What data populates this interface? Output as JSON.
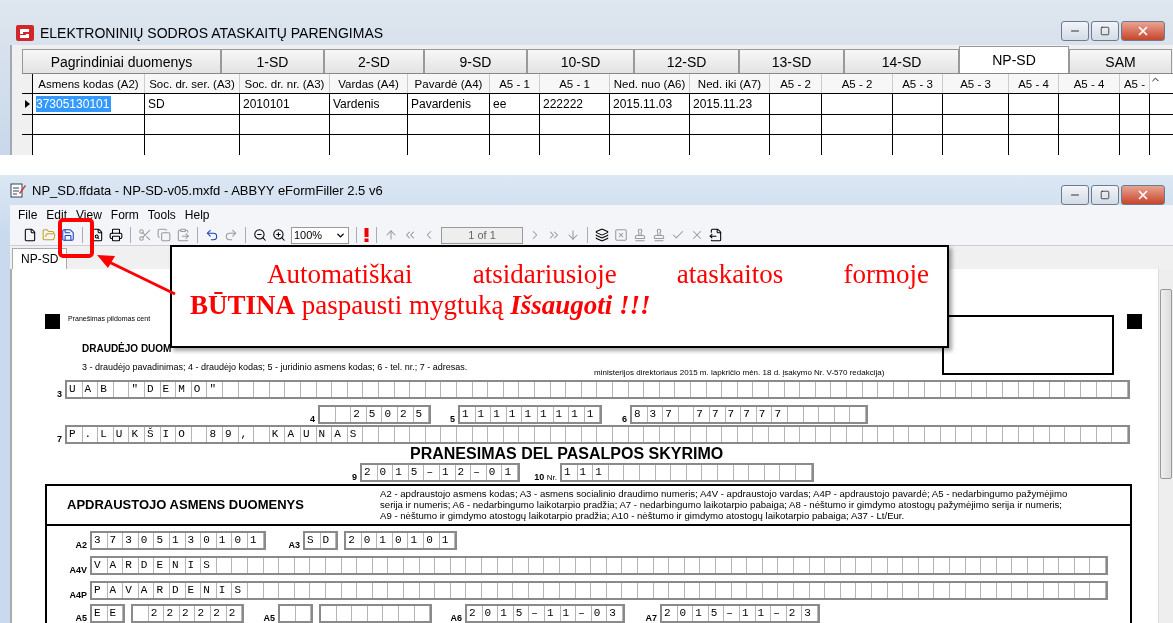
{
  "top_window": {
    "title": "ELEKTRONINIŲ SODROS ATASKAITŲ PARENGIMAS",
    "tabs": [
      {
        "label": "Pagrindiniai duomenys",
        "selected": false
      },
      {
        "label": "1-SD",
        "selected": false
      },
      {
        "label": "2-SD",
        "selected": false
      },
      {
        "label": "9-SD",
        "selected": false
      },
      {
        "label": "10-SD",
        "selected": false
      },
      {
        "label": "12-SD",
        "selected": false
      },
      {
        "label": "13-SD",
        "selected": false
      },
      {
        "label": "14-SD",
        "selected": false
      },
      {
        "label": "NP-SD",
        "selected": true
      },
      {
        "label": "SAM",
        "selected": false
      }
    ],
    "table": {
      "columns": [
        "Asmens kodas (A2)",
        "Soc. dr. ser. (A3)",
        "Soc. dr. nr. (A3)",
        "Vardas (A4)",
        "Pavardė (A4)",
        "A5 - 1",
        "A5 - 1",
        "Ned. nuo (A6)",
        "Ned. iki (A7)",
        "A5 - 2",
        "A5 - 2",
        "A5 - 3",
        "A5 - 3",
        "A5 - 4",
        "A5 - 4",
        "A5 -"
      ],
      "rows": [
        {
          "selected": true,
          "cells": [
            "37305130101",
            "SD",
            "2010101",
            "Vardenis",
            "Pavardenis",
            "ee",
            "222222",
            "2015.11.03",
            "2015.11.23"
          ]
        }
      ]
    }
  },
  "bottom_window": {
    "title": "NP_SD.ffdata - NP-SD-v05.mxfd - ABBYY eFormFiller 2.5 v6",
    "menu": [
      "File",
      "Edit",
      "View",
      "Form",
      "Tools",
      "Help"
    ],
    "toolbar": {
      "zoom": "100%",
      "page": "1 of 1"
    },
    "document_tab": "NP-SD",
    "form": {
      "note": "Pranešimas pildomas cent",
      "heading": "DRAUDĖJO DUOM",
      "legend": "3 - draudėjo pavadinimas; 4 - draudėjo kodas; 5 - juridinio asmens kodas; 6 - tel. nr.; 7 - adresas.",
      "order_note": "ministerijos direktoriaus 2015 m. lapkričio mėn. 18 d. įsakymo Nr. V-570 redakcija)",
      "field_3": {
        "label": "3",
        "value": "UAB \"DEMO\""
      },
      "fields_4_6": [
        {
          "label": "4",
          "value": "25025"
        },
        {
          "label": "5",
          "value": "111111111"
        },
        {
          "label": "6",
          "value": "837 777777"
        }
      ],
      "field_7": {
        "label": "7",
        "value": "P.LUKŠIO 89, KAUNAS"
      },
      "title": "PRANESIMAS DEL PASALPOS SKYRIMO",
      "date": {
        "label": "9",
        "value": "2015–12–01"
      },
      "number": {
        "label": "10",
        "prefix": "Nr.",
        "value": "111"
      },
      "insured": {
        "heading": "APDRAUSTOJO ASMENS DUOMENYS",
        "legend": "A2 - apdraustojo asmens kodas; A3 - asmens socialinio draudimo numeris; A4V - apdraustojo vardas; A4P - apdraustojo pavardė; A5 - nedarbingumo pažymėjimo serija ir numeris; A6 - nedarbingumo laikotarpio pradžia; A7 - nedarbingumo laikotarpio pabaiga; A8 - nėštumo ir gimdymo atostogų pažymėjimo serija ir numeris; A9 - nėštumo ir gimdymo atostogų laikotarpio pradžia; A10 - nėštumo ir gimdymo atostogų laikotarpio pabaiga; A37 - Lt/Eur.",
        "rows": [
          [
            {
              "label": "A2",
              "values": [
                "37305130101"
              ]
            },
            {
              "label": "A3",
              "values": [
                "SD",
                "2010101"
              ]
            }
          ],
          [
            {
              "label": "A4V",
              "values": [
                "VARDENIS"
              ]
            }
          ],
          [
            {
              "label": "A4P",
              "values": [
                "PAVARDENIS"
              ]
            }
          ],
          [
            {
              "label": "A5",
              "values": [
                "EE",
                "222222"
              ]
            },
            {
              "label": "A5"
            },
            {
              "label": "A6",
              "values": [
                "2015–11–03"
              ]
            },
            {
              "label": "A7",
              "values": [
                "2015–11–23"
              ]
            }
          ]
        ]
      }
    },
    "callout": {
      "line_1": "Automatiškai atsidariusioje ataskaitos formoje",
      "line_2": "**BŪTINA** paspausti mygtuką *Išsaugoti !!!*"
    }
  }
}
